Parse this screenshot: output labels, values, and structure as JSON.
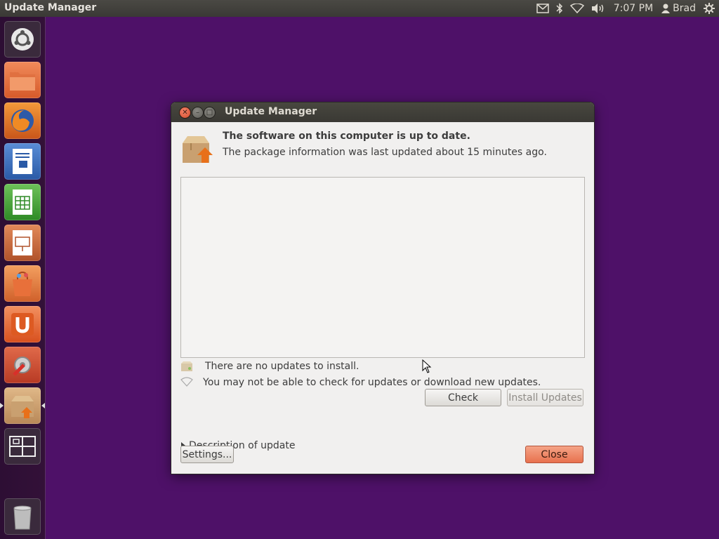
{
  "top_panel": {
    "title": "Update Manager",
    "clock": "7:07 PM",
    "user": "Brad"
  },
  "window": {
    "title": "Update Manager",
    "headline": "The software on this computer is up to date.",
    "subline": "The package information was last updated about 15 minutes ago.",
    "status_no_updates": "There are no updates to install.",
    "status_network": "You may not be able to check for updates or download new updates.",
    "check_label": "Check",
    "install_label": "Install Updates",
    "description_label": "Description of update",
    "settings_label": "Settings...",
    "close_label": "Close"
  },
  "colors": {
    "desktop": "#4e1168",
    "panel": "#3c3b37",
    "accent": "#e8714e"
  },
  "launcher": {
    "items": [
      "dash-home-icon",
      "files-icon",
      "firefox-icon",
      "writer-icon",
      "calc-icon",
      "impress-icon",
      "software-center-icon",
      "ubuntu-one-icon",
      "system-settings-icon",
      "update-manager-icon",
      "workspace-switcher-icon",
      "trash-icon"
    ]
  }
}
